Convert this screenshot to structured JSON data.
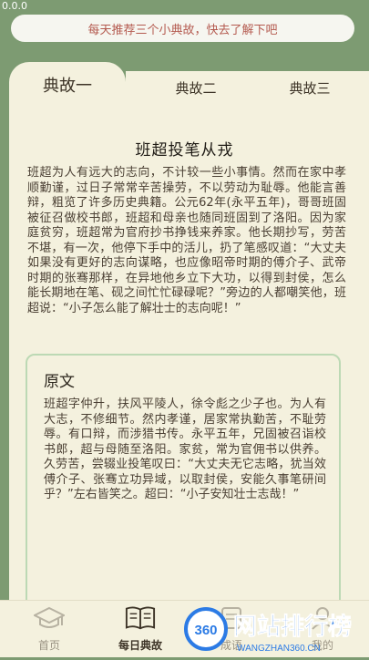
{
  "status": {
    "time": "0.0.0"
  },
  "banner": {
    "text": "每天推荐三个小典故，快去了解下吧"
  },
  "tabs": [
    {
      "label": "典故一"
    },
    {
      "label": "典故二"
    },
    {
      "label": "典故三"
    }
  ],
  "story": {
    "title": "班超投笔从戎",
    "body": "班超为人有远大的志向，不计较一些小事情。然而在家中孝顺勤谨，过日子常常辛苦操劳，不以劳动为耻辱。他能言善辩，粗览了许多历史典籍。公元62年(永平五年)，哥哥班固被征召做校书郎，班超和母亲也随同班固到了洛阳。因为家庭贫穷，班超常为官府抄书挣钱来养家。他长期抄写，劳苦不堪，有一次，他停下手中的活儿，扔了笔感叹道：“大丈夫如果没有更好的志向谋略，也应像昭帝时期的傅介子、武帝时期的张骞那样，在异地他乡立下大功，以得到封侯，怎么能长期地在笔、砚之间忙忙碌碌呢？”旁边的人都嘲笑他，班超说：“小子怎么能了解壮士的志向呢！”"
  },
  "original": {
    "heading": "原文",
    "body": "班超字仲升，扶风平陵人，徐令彪之少子也。为人有大志，不修细节。然内孝谨，居家常执勤苦，不耻劳辱。有口辩，而涉猎书传。永平五年，兄固被召诣校书郎，超与母随至洛阳。家贫，常为官佣书以供养。久劳苦，尝辍业投笔叹曰：“大丈夫无它志略，犹当效傅介子、张骞立功异域，以取封侯，安能久事笔研间乎？”左右皆笑之。超曰：“小子安知壮士志哉！”"
  },
  "nav": [
    {
      "label": "首页",
      "icon": "graduation-cap-icon"
    },
    {
      "label": "每日典故",
      "icon": "book-icon"
    },
    {
      "label": "成语",
      "icon": "scroll-icon"
    },
    {
      "label": "我的",
      "icon": "user-icon"
    }
  ],
  "watermark": {
    "brand": "网站排行榜",
    "badge": "360",
    "url": "WANGZHAN360.CN"
  },
  "colors": {
    "background": "#7d9b72",
    "panel": "#f4f1de",
    "banner_text": "#b45a4f",
    "card_border": "#bcd9b4"
  }
}
